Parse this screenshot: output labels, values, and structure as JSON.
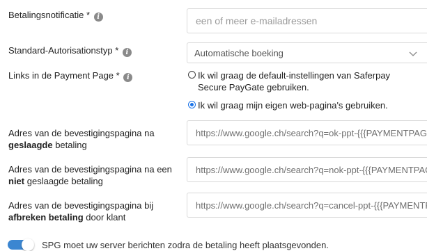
{
  "form": {
    "betalingsnotificatie": {
      "label": "Betalingsnotificatie *",
      "placeholder": "een of meer e-mailadressen"
    },
    "autorisationstyp": {
      "label": "Standard-Autorisationstyp *",
      "selected": "Automatische boeking"
    },
    "links_payment_page": {
      "label": "Links in de Payment Page *",
      "options": [
        {
          "label": "Ik wil graag de default-instellingen van Saferpay Secure PayGate gebruiken.",
          "checked": false
        },
        {
          "label": "Ik wil graag mijn eigen web-pagina's gebruiken.",
          "checked": true
        }
      ]
    },
    "success_url": {
      "label_pre": "Adres van de bevestigingspagina na",
      "label_bold": "geslaagde",
      "label_post": " betaling",
      "value": "https://www.google.ch/search?q=ok-ppt-{{{PAYMENTPAGETOKEN}}}"
    },
    "fail_url": {
      "label_pre": "Adres van de bevestigingspagina na een",
      "label_bold": "niet",
      "label_post": " geslaagde betaling",
      "value": "https://www.google.ch/search?q=nok-ppt-{{{PAYMENTPAGETOKEN}}}"
    },
    "abort_url": {
      "label_pre": "Adres van de bevestigingspagina bij",
      "label_bold": "afbreken betaling",
      "label_post": " door klant",
      "value": "https://www.google.ch/search?q=cancel-ppt-{{{PAYMENTPAGETOKEN}}}"
    },
    "notify_toggle": {
      "on": true,
      "label": "SPG moet uw server berichten zodra de betaling heeft plaatsgevonden."
    }
  },
  "colors": {
    "accent": "#1a73e8",
    "toggle_on": "#3b86d1",
    "info_icon": "#8a8a8a",
    "border": "#d9d9d9"
  }
}
